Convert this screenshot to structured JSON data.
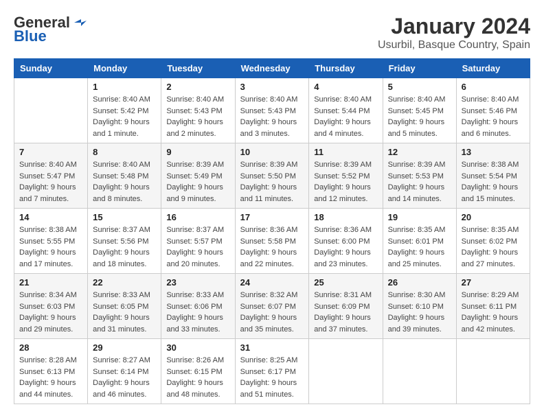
{
  "logo": {
    "general": "General",
    "blue": "Blue"
  },
  "title": "January 2024",
  "subtitle": "Usurbil, Basque Country, Spain",
  "days_of_week": [
    "Sunday",
    "Monday",
    "Tuesday",
    "Wednesday",
    "Thursday",
    "Friday",
    "Saturday"
  ],
  "weeks": [
    [
      {
        "day": "",
        "info": ""
      },
      {
        "day": "1",
        "info": "Sunrise: 8:40 AM\nSunset: 5:42 PM\nDaylight: 9 hours\nand 1 minute."
      },
      {
        "day": "2",
        "info": "Sunrise: 8:40 AM\nSunset: 5:43 PM\nDaylight: 9 hours\nand 2 minutes."
      },
      {
        "day": "3",
        "info": "Sunrise: 8:40 AM\nSunset: 5:43 PM\nDaylight: 9 hours\nand 3 minutes."
      },
      {
        "day": "4",
        "info": "Sunrise: 8:40 AM\nSunset: 5:44 PM\nDaylight: 9 hours\nand 4 minutes."
      },
      {
        "day": "5",
        "info": "Sunrise: 8:40 AM\nSunset: 5:45 PM\nDaylight: 9 hours\nand 5 minutes."
      },
      {
        "day": "6",
        "info": "Sunrise: 8:40 AM\nSunset: 5:46 PM\nDaylight: 9 hours\nand 6 minutes."
      }
    ],
    [
      {
        "day": "7",
        "info": "Sunrise: 8:40 AM\nSunset: 5:47 PM\nDaylight: 9 hours\nand 7 minutes."
      },
      {
        "day": "8",
        "info": "Sunrise: 8:40 AM\nSunset: 5:48 PM\nDaylight: 9 hours\nand 8 minutes."
      },
      {
        "day": "9",
        "info": "Sunrise: 8:39 AM\nSunset: 5:49 PM\nDaylight: 9 hours\nand 9 minutes."
      },
      {
        "day": "10",
        "info": "Sunrise: 8:39 AM\nSunset: 5:50 PM\nDaylight: 9 hours\nand 11 minutes."
      },
      {
        "day": "11",
        "info": "Sunrise: 8:39 AM\nSunset: 5:52 PM\nDaylight: 9 hours\nand 12 minutes."
      },
      {
        "day": "12",
        "info": "Sunrise: 8:39 AM\nSunset: 5:53 PM\nDaylight: 9 hours\nand 14 minutes."
      },
      {
        "day": "13",
        "info": "Sunrise: 8:38 AM\nSunset: 5:54 PM\nDaylight: 9 hours\nand 15 minutes."
      }
    ],
    [
      {
        "day": "14",
        "info": "Sunrise: 8:38 AM\nSunset: 5:55 PM\nDaylight: 9 hours\nand 17 minutes."
      },
      {
        "day": "15",
        "info": "Sunrise: 8:37 AM\nSunset: 5:56 PM\nDaylight: 9 hours\nand 18 minutes."
      },
      {
        "day": "16",
        "info": "Sunrise: 8:37 AM\nSunset: 5:57 PM\nDaylight: 9 hours\nand 20 minutes."
      },
      {
        "day": "17",
        "info": "Sunrise: 8:36 AM\nSunset: 5:58 PM\nDaylight: 9 hours\nand 22 minutes."
      },
      {
        "day": "18",
        "info": "Sunrise: 8:36 AM\nSunset: 6:00 PM\nDaylight: 9 hours\nand 23 minutes."
      },
      {
        "day": "19",
        "info": "Sunrise: 8:35 AM\nSunset: 6:01 PM\nDaylight: 9 hours\nand 25 minutes."
      },
      {
        "day": "20",
        "info": "Sunrise: 8:35 AM\nSunset: 6:02 PM\nDaylight: 9 hours\nand 27 minutes."
      }
    ],
    [
      {
        "day": "21",
        "info": "Sunrise: 8:34 AM\nSunset: 6:03 PM\nDaylight: 9 hours\nand 29 minutes."
      },
      {
        "day": "22",
        "info": "Sunrise: 8:33 AM\nSunset: 6:05 PM\nDaylight: 9 hours\nand 31 minutes."
      },
      {
        "day": "23",
        "info": "Sunrise: 8:33 AM\nSunset: 6:06 PM\nDaylight: 9 hours\nand 33 minutes."
      },
      {
        "day": "24",
        "info": "Sunrise: 8:32 AM\nSunset: 6:07 PM\nDaylight: 9 hours\nand 35 minutes."
      },
      {
        "day": "25",
        "info": "Sunrise: 8:31 AM\nSunset: 6:09 PM\nDaylight: 9 hours\nand 37 minutes."
      },
      {
        "day": "26",
        "info": "Sunrise: 8:30 AM\nSunset: 6:10 PM\nDaylight: 9 hours\nand 39 minutes."
      },
      {
        "day": "27",
        "info": "Sunrise: 8:29 AM\nSunset: 6:11 PM\nDaylight: 9 hours\nand 42 minutes."
      }
    ],
    [
      {
        "day": "28",
        "info": "Sunrise: 8:28 AM\nSunset: 6:13 PM\nDaylight: 9 hours\nand 44 minutes."
      },
      {
        "day": "29",
        "info": "Sunrise: 8:27 AM\nSunset: 6:14 PM\nDaylight: 9 hours\nand 46 minutes."
      },
      {
        "day": "30",
        "info": "Sunrise: 8:26 AM\nSunset: 6:15 PM\nDaylight: 9 hours\nand 48 minutes."
      },
      {
        "day": "31",
        "info": "Sunrise: 8:25 AM\nSunset: 6:17 PM\nDaylight: 9 hours\nand 51 minutes."
      },
      {
        "day": "",
        "info": ""
      },
      {
        "day": "",
        "info": ""
      },
      {
        "day": "",
        "info": ""
      }
    ]
  ]
}
